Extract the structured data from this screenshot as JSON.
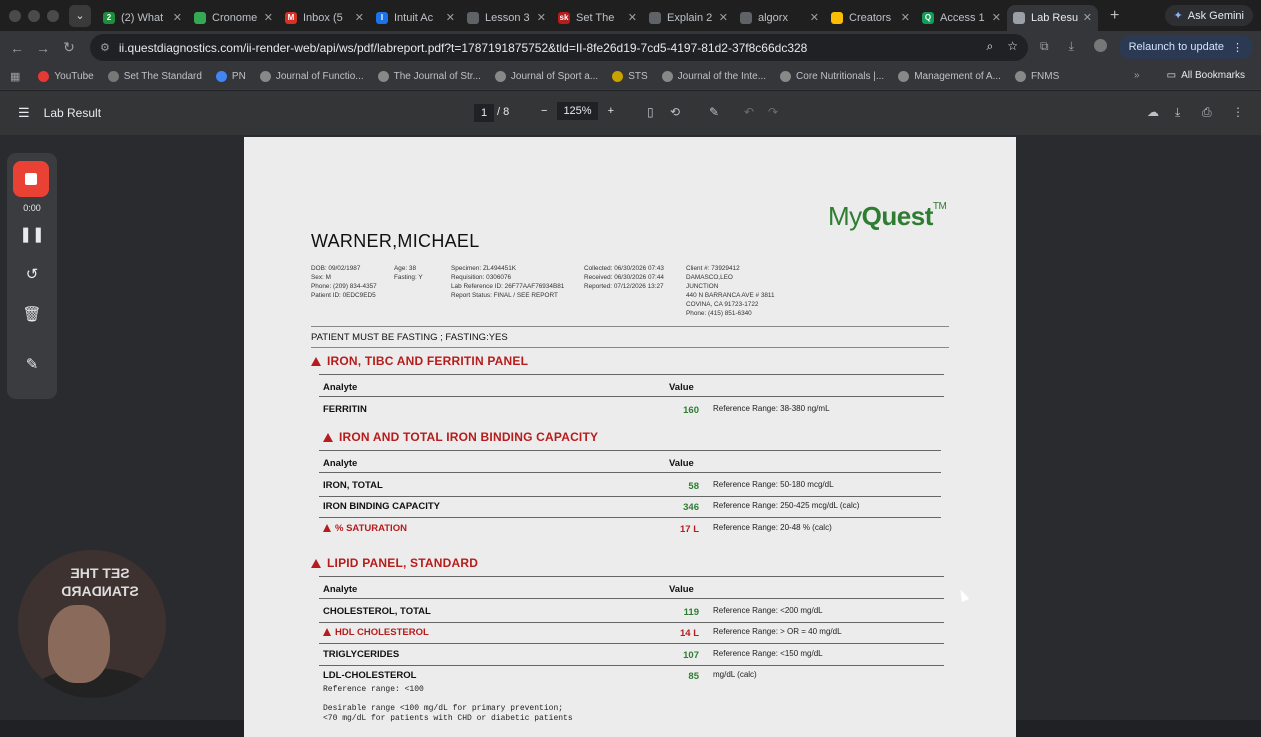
{
  "tabs": [
    {
      "title": "(2) What",
      "fav": "2",
      "color": "#1e8e3e"
    },
    {
      "title": "Cronome",
      "fav": "",
      "color": "#34a853"
    },
    {
      "title": "Inbox (5",
      "fav": "M",
      "color": "#d93025"
    },
    {
      "title": "Intuit Ac",
      "fav": "I",
      "color": "#1a73e8"
    },
    {
      "title": "Lesson 3",
      "fav": "",
      "color": "#5f6368"
    },
    {
      "title": "Set The",
      "fav": "sk",
      "color": "#b71c1c"
    },
    {
      "title": "Explain 2",
      "fav": "",
      "color": "#5f6368"
    },
    {
      "title": "algorx",
      "fav": "",
      "color": "#5f6368"
    },
    {
      "title": "Creators",
      "fav": "",
      "color": "#fbbc04"
    },
    {
      "title": "Access 1",
      "fav": "Q",
      "color": "#0f9d58"
    },
    {
      "title": "Lab Resu",
      "fav": "",
      "color": "#9aa0a6",
      "active": true
    }
  ],
  "browser": {
    "ask_gemini": "Ask Gemini",
    "url": "ii.questdiagnostics.com/ii-render-web/api/ws/pdf/labreport.pdf?t=1787191875752&tld=II-8fe26d19-7cd5-4197-81d2-37f8c66dc328",
    "relaunch": "Relaunch to update"
  },
  "bookmarks": [
    {
      "label": "YouTube",
      "color": "#e53935"
    },
    {
      "label": "Set The Standard",
      "color": "#777"
    },
    {
      "label": "PN",
      "color": "#4285f4"
    },
    {
      "label": "Journal of Functio...",
      "color": "#888"
    },
    {
      "label": "The Journal of Str...",
      "color": "#888"
    },
    {
      "label": "Journal of Sport a...",
      "color": "#888"
    },
    {
      "label": "STS",
      "color": "#c8a200"
    },
    {
      "label": "Journal of the Inte...",
      "color": "#888"
    },
    {
      "label": "Core Nutritionals |...",
      "color": "#888"
    },
    {
      "label": "Management of A...",
      "color": "#888"
    },
    {
      "label": "FNMS",
      "color": "#888"
    }
  ],
  "all_bookmarks": "All Bookmarks",
  "pdf": {
    "title": "Lab Result",
    "page": "1",
    "of": "/  8",
    "zoom": "125%"
  },
  "recorder": {
    "time": "0:00"
  },
  "report": {
    "logo_a": "My",
    "logo_b": "Quest",
    "logo_tm": "TM",
    "patient_name": "WARNER,MICHAEL",
    "meta_col1": [
      "DOB: 09/02/1987",
      "Sex: M",
      "Phone: (209) 834-4357",
      "Patient ID: 0EDC9ED5"
    ],
    "meta_col2": [
      "Age: 38",
      "Fasting: Y"
    ],
    "meta_col3": [
      "Specimen: ZL494451K",
      "Requisition: 0306076",
      "Lab Reference ID: 26F77AAF76934B81",
      "Report Status: FINAL / SEE REPORT"
    ],
    "meta_col4": [
      "Collected: 06/30/2026 07:43",
      "Received: 06/30/2026 07:44",
      "Reported: 07/12/2026 13:27"
    ],
    "meta_col5": [
      "Client #: 73929412",
      "DAMASCO,LEO",
      "JUNCTION",
      "440 N BARRANCA AVE # 3811",
      "COVINA, CA 91723-1722",
      "Phone: (415) 851-6340"
    ],
    "fasting_note": "PATIENT MUST BE FASTING ; FASTING:YES",
    "col_analyte": "Analyte",
    "col_value": "Value",
    "sections": [
      {
        "title": "IRON, TIBC AND FERRITIN PANEL",
        "rows": [
          {
            "name": "FERRITIN",
            "value": "160",
            "ref": "Reference Range: 38-380 ng/mL",
            "flag": false
          }
        ]
      },
      {
        "title": "IRON AND TOTAL IRON BINDING CAPACITY",
        "rows": [
          {
            "name": "IRON, TOTAL",
            "value": "58",
            "ref": "Reference Range: 50-180 mcg/dL",
            "flag": false
          },
          {
            "name": "IRON BINDING CAPACITY",
            "value": "346",
            "ref": "Reference Range: 250-425 mcg/dL (calc)",
            "flag": false
          },
          {
            "name": "% SATURATION",
            "value": "17 L",
            "ref": "Reference Range: 20-48 % (calc)",
            "flag": true
          }
        ]
      },
      {
        "title": "LIPID PANEL, STANDARD",
        "rows": [
          {
            "name": "CHOLESTEROL, TOTAL",
            "value": "119",
            "ref": "Reference Range: <200 mg/dL",
            "flag": false
          },
          {
            "name": "HDL CHOLESTEROL",
            "value": "14 L",
            "ref": "Reference Range: > OR = 40 mg/dL",
            "flag": true
          },
          {
            "name": "TRIGLYCERIDES",
            "value": "107",
            "ref": "Reference Range: <150 mg/dL",
            "flag": false
          },
          {
            "name": "LDL-CHOLESTEROL",
            "value": "85",
            "ref": "mg/dL (calc)",
            "flag": false
          }
        ]
      }
    ],
    "ldl_ref": "Reference range: <100",
    "ldl_note1": "Desirable range <100 mg/dL for primary prevention;",
    "ldl_note2": "<70 mg/dL for patients with CHD or diabetic patients"
  },
  "webcam": {
    "sign": "SET THE STANDARD"
  }
}
